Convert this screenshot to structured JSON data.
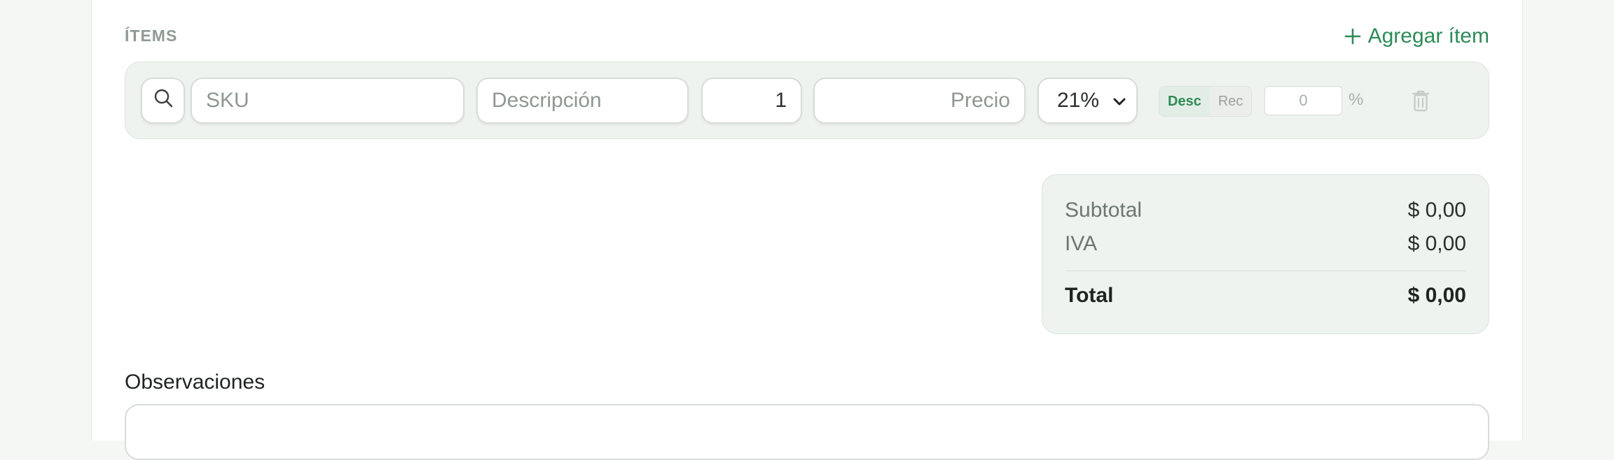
{
  "items_section": {
    "title": "ÍTEMS",
    "add_item_label": "Agregar ítem"
  },
  "item_row": {
    "sku_placeholder": "SKU",
    "description_placeholder": "Descripción",
    "quantity_value": "1",
    "price_placeholder": "Precio",
    "tax_rate_value": "21%",
    "discount_toggle": {
      "options": [
        "Desc",
        "Rec"
      ],
      "selected": "Desc"
    },
    "percent_value": "0",
    "percent_sign": "%"
  },
  "totals": {
    "subtotal_label": "Subtotal",
    "subtotal_value": "$ 0,00",
    "iva_label": "IVA",
    "iva_value": "$ 0,00",
    "total_label": "Total",
    "total_value": "$ 0,00"
  },
  "observations": {
    "label": "Observaciones"
  },
  "colors": {
    "accent": "#2e8b57",
    "panel": "#eef3ef",
    "background": "#f5f7f5"
  },
  "icons": [
    "plus-icon",
    "search-icon",
    "chevron-down-icon",
    "trash-icon"
  ]
}
